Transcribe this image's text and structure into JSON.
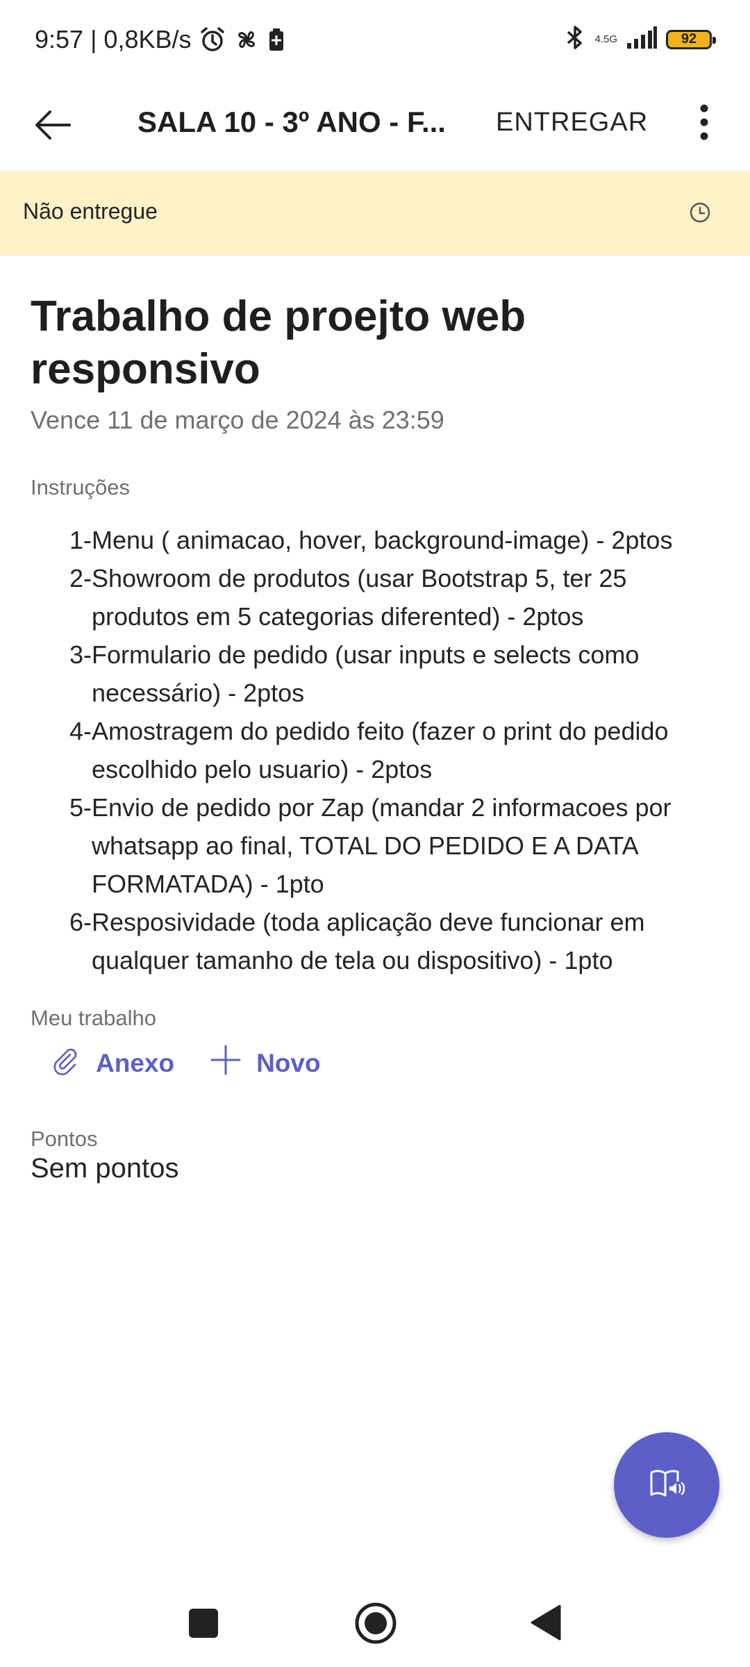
{
  "status_bar": {
    "time_speed": "9:57 | 0,8KB/s",
    "network": "4.5G",
    "battery": "92",
    "icons": [
      "alarm-icon",
      "fan-icon",
      "battery-saver-icon",
      "bluetooth-icon",
      "signal-icon"
    ]
  },
  "app_bar": {
    "title": "SALA 10 - 3º ANO - F...",
    "action": "ENTREGAR",
    "icons": [
      "back-arrow-icon",
      "more-vert-icon"
    ]
  },
  "banner": {
    "text": "Não entregue",
    "icon": "clock-icon",
    "color": "#fdf1c7"
  },
  "assignment": {
    "title": "Trabalho de proejto web responsivo",
    "due": "Vence 11 de março de 2024 às 23:59",
    "instructions_label": "Instruções",
    "instructions": [
      "1-Menu ( animacao, hover, background-image) - 2ptos",
      "2-Showroom de produtos (usar Bootstrap 5, ter 25 produtos em 5 categorias diferented) - 2ptos",
      "3-Formulario de pedido (usar inputs e selects como necessário) - 2ptos",
      "4-Amostragem do pedido feito (fazer o print do pedido escolhido pelo usuario) - 2ptos",
      "5-Envio de pedido por Zap (mandar 2 informacoes por whatsapp ao final, TOTAL DO PEDIDO E A DATA FORMATADA) - 1pto",
      "6-Resposividade (toda aplicação deve funcionar em qualquer tamanho de tela ou dispositivo) - 1pto"
    ],
    "my_work_label": "Meu trabalho",
    "attach_label": "Anexo",
    "new_label": "Novo",
    "points_label": "Pontos",
    "points_value": "Sem pontos"
  },
  "accent_color": "#5b5fc7",
  "fab_icon": "immersive-reader-icon",
  "nav_icons": [
    "recents-square-icon",
    "home-circle-icon",
    "back-triangle-icon"
  ]
}
